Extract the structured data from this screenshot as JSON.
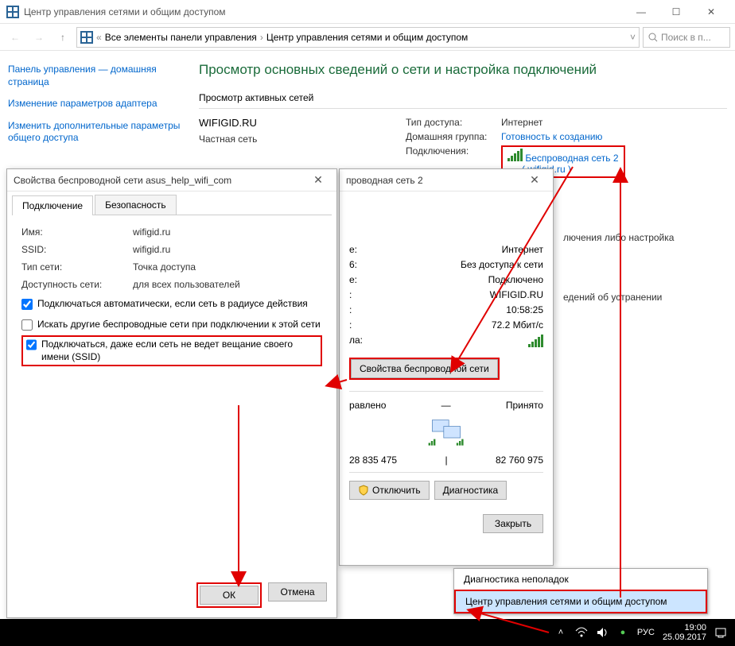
{
  "window": {
    "title": "Центр управления сетями и общим доступом",
    "breadcrumb_parent": "Все элементы панели управления",
    "breadcrumb_current": "Центр управления сетями и общим доступом",
    "search_placeholder": "Поиск в п..."
  },
  "sidebar": {
    "home": "Панель управления — домашняя страница",
    "adapter": "Изменение параметров адаптера",
    "sharing": "Изменить дополнительные параметры общего доступа"
  },
  "main": {
    "heading": "Просмотр основных сведений о сети и настройка подключений",
    "active_label": "Просмотр активных сетей",
    "net_name": "WIFIGID.RU",
    "net_type": "Частная сеть",
    "access_label": "Тип доступа:",
    "access_value": "Интернет",
    "homegroup_label": "Домашняя группа:",
    "homegroup_value": "Готовность к созданию",
    "conn_label": "Подключения:",
    "conn_name": "Беспроводная сеть 2",
    "conn_sub": "( wifigid.ru )",
    "peek1": "лючения либо настройка",
    "peek2": "едений об устранении"
  },
  "dlg_props": {
    "title": "Свойства беспроводной сети asus_help_wifi_com",
    "tab_conn": "Подключение",
    "tab_sec": "Безопасность",
    "name_label": "Имя:",
    "name_value": "wifigid.ru",
    "ssid_label": "SSID:",
    "ssid_value": "wifigid.ru",
    "nettype_label": "Тип сети:",
    "nettype_value": "Точка доступа",
    "avail_label": "Доступность сети:",
    "avail_value": "для всех пользователей",
    "cb1": "Подключаться автоматически, если сеть в радиусе действия",
    "cb2": "Искать другие беспроводные сети при подключении к этой сети",
    "cb3": "Подключаться, даже если сеть не ведет вещание своего имени (SSID)",
    "ok": "ОК",
    "cancel": "Отмена"
  },
  "dlg_status": {
    "title": "проводная сеть 2",
    "l_inet": "е:",
    "v_inet": "Интернет",
    "l_ipv6": "6:",
    "v_ipv6": "Без доступа к сети",
    "l_state": "е:",
    "v_state": "Подключено",
    "l_ssid": ":",
    "v_ssid": "WIFIGID.RU",
    "l_dur": ":",
    "v_dur": "10:58:25",
    "l_speed": ":",
    "v_speed": "72.2 Мбит/с",
    "l_quality": "ла:",
    "btn_wprops": "Свойства беспроводной сети",
    "sent_label": "равлено",
    "recv_label": "Принято",
    "sent_val": "28 835 475",
    "recv_val": "82 760 975",
    "btn_disconnect": "Отключить",
    "btn_diag": "Диагностика",
    "btn_close": "Закрыть"
  },
  "ctxmenu": {
    "item1": "Диагностика неполадок",
    "item2": "Центр управления сетями и общим доступом"
  },
  "taskbar": {
    "lang": "РУС",
    "time": "19:00",
    "date": "25.09.2017"
  }
}
